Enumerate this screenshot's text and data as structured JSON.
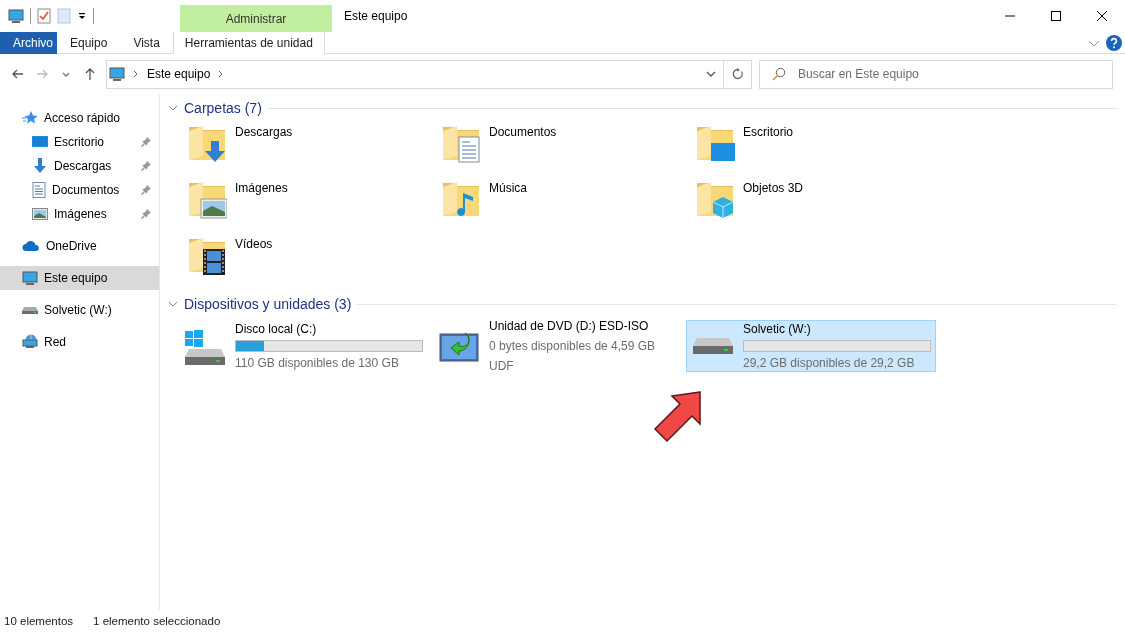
{
  "window": {
    "title": "Este equipo",
    "context_group": "Administrar"
  },
  "ribbon_tabs": [
    {
      "label": "Archivo",
      "kind": "file",
      "selected": false
    },
    {
      "label": "Equipo",
      "kind": "tab",
      "selected": false
    },
    {
      "label": "Vista",
      "kind": "tab",
      "selected": false
    },
    {
      "label": "Herramientas de unidad",
      "kind": "context",
      "selected": false
    }
  ],
  "address_bar": {
    "path": [
      "Este equipo"
    ]
  },
  "search": {
    "placeholder": "Buscar en Este equipo"
  },
  "sidebar": {
    "items": [
      {
        "label": "Acceso rápido",
        "kind": "star",
        "selected": false,
        "children": [
          {
            "label": "Escritorio",
            "kind": "desktop",
            "pinned": true,
            "selected": false
          },
          {
            "label": "Descargas",
            "kind": "downloads",
            "pinned": true,
            "selected": false
          },
          {
            "label": "Documentos",
            "kind": "documents",
            "pinned": true,
            "selected": false
          },
          {
            "label": "Imágenes",
            "kind": "pictures",
            "pinned": true,
            "selected": false
          }
        ]
      },
      {
        "label": "OneDrive",
        "kind": "cloud",
        "selected": false
      },
      {
        "label": "Este equipo",
        "kind": "computer",
        "selected": true
      },
      {
        "label": "Solvetic (W:)",
        "kind": "drive",
        "selected": false
      },
      {
        "label": "Red",
        "kind": "network",
        "selected": false
      }
    ]
  },
  "sections": [
    {
      "title": "Carpetas (7)",
      "expanded": true,
      "kind": "folders",
      "items": [
        {
          "label": "Descargas",
          "kind": "downloads",
          "selected": false
        },
        {
          "label": "Documentos",
          "kind": "documents",
          "selected": false
        },
        {
          "label": "Escritorio",
          "kind": "desktop",
          "selected": false
        },
        {
          "label": "Imágenes",
          "kind": "pictures",
          "selected": false
        },
        {
          "label": "Música",
          "kind": "music",
          "selected": false
        },
        {
          "label": "Objetos 3D",
          "kind": "objects3d",
          "selected": false
        },
        {
          "label": "Vídeos",
          "kind": "videos",
          "selected": false
        }
      ]
    },
    {
      "title": "Dispositivos y unidades (3)",
      "expanded": true,
      "kind": "drives",
      "items": [
        {
          "label": "Disco local (C:)",
          "kind": "system-disk",
          "level": 0.15,
          "detail": "110 GB disponibles de 130 GB",
          "selected": false
        },
        {
          "label": "Unidad de DVD (D:) ESD-ISO",
          "kind": "dvd",
          "detail": "0 bytes disponibles de 4,59 GB",
          "filesystem": "UDF",
          "selected": false
        },
        {
          "label": "Solvetic (W:)",
          "kind": "disk",
          "level": 0,
          "detail": "29,2 GB disponibles de 29,2 GB",
          "selected": true
        }
      ]
    }
  ],
  "annotation": {
    "kind": "arrow"
  },
  "status_bar": {
    "count": "10 elementos",
    "selection": "1 elemento seleccionado"
  }
}
